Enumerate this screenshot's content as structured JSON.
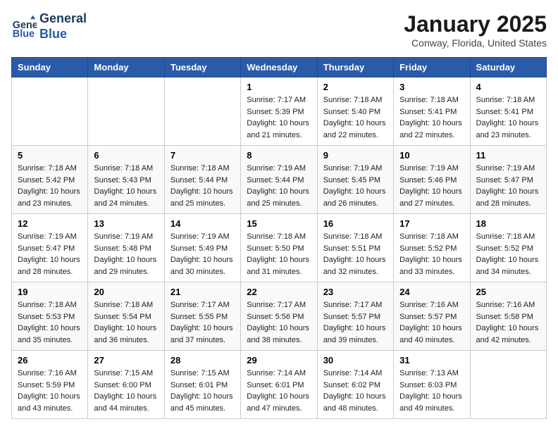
{
  "header": {
    "logo_line1": "General",
    "logo_line2": "Blue",
    "month_title": "January 2025",
    "location": "Conway, Florida, United States"
  },
  "days_of_week": [
    "Sunday",
    "Monday",
    "Tuesday",
    "Wednesday",
    "Thursday",
    "Friday",
    "Saturday"
  ],
  "weeks": [
    [
      {
        "day": "",
        "info": ""
      },
      {
        "day": "",
        "info": ""
      },
      {
        "day": "",
        "info": ""
      },
      {
        "day": "1",
        "info": "Sunrise: 7:17 AM\nSunset: 5:39 PM\nDaylight: 10 hours\nand 21 minutes."
      },
      {
        "day": "2",
        "info": "Sunrise: 7:18 AM\nSunset: 5:40 PM\nDaylight: 10 hours\nand 22 minutes."
      },
      {
        "day": "3",
        "info": "Sunrise: 7:18 AM\nSunset: 5:41 PM\nDaylight: 10 hours\nand 22 minutes."
      },
      {
        "day": "4",
        "info": "Sunrise: 7:18 AM\nSunset: 5:41 PM\nDaylight: 10 hours\nand 23 minutes."
      }
    ],
    [
      {
        "day": "5",
        "info": "Sunrise: 7:18 AM\nSunset: 5:42 PM\nDaylight: 10 hours\nand 23 minutes."
      },
      {
        "day": "6",
        "info": "Sunrise: 7:18 AM\nSunset: 5:43 PM\nDaylight: 10 hours\nand 24 minutes."
      },
      {
        "day": "7",
        "info": "Sunrise: 7:18 AM\nSunset: 5:44 PM\nDaylight: 10 hours\nand 25 minutes."
      },
      {
        "day": "8",
        "info": "Sunrise: 7:19 AM\nSunset: 5:44 PM\nDaylight: 10 hours\nand 25 minutes."
      },
      {
        "day": "9",
        "info": "Sunrise: 7:19 AM\nSunset: 5:45 PM\nDaylight: 10 hours\nand 26 minutes."
      },
      {
        "day": "10",
        "info": "Sunrise: 7:19 AM\nSunset: 5:46 PM\nDaylight: 10 hours\nand 27 minutes."
      },
      {
        "day": "11",
        "info": "Sunrise: 7:19 AM\nSunset: 5:47 PM\nDaylight: 10 hours\nand 28 minutes."
      }
    ],
    [
      {
        "day": "12",
        "info": "Sunrise: 7:19 AM\nSunset: 5:47 PM\nDaylight: 10 hours\nand 28 minutes."
      },
      {
        "day": "13",
        "info": "Sunrise: 7:19 AM\nSunset: 5:48 PM\nDaylight: 10 hours\nand 29 minutes."
      },
      {
        "day": "14",
        "info": "Sunrise: 7:19 AM\nSunset: 5:49 PM\nDaylight: 10 hours\nand 30 minutes."
      },
      {
        "day": "15",
        "info": "Sunrise: 7:18 AM\nSunset: 5:50 PM\nDaylight: 10 hours\nand 31 minutes."
      },
      {
        "day": "16",
        "info": "Sunrise: 7:18 AM\nSunset: 5:51 PM\nDaylight: 10 hours\nand 32 minutes."
      },
      {
        "day": "17",
        "info": "Sunrise: 7:18 AM\nSunset: 5:52 PM\nDaylight: 10 hours\nand 33 minutes."
      },
      {
        "day": "18",
        "info": "Sunrise: 7:18 AM\nSunset: 5:52 PM\nDaylight: 10 hours\nand 34 minutes."
      }
    ],
    [
      {
        "day": "19",
        "info": "Sunrise: 7:18 AM\nSunset: 5:53 PM\nDaylight: 10 hours\nand 35 minutes."
      },
      {
        "day": "20",
        "info": "Sunrise: 7:18 AM\nSunset: 5:54 PM\nDaylight: 10 hours\nand 36 minutes."
      },
      {
        "day": "21",
        "info": "Sunrise: 7:17 AM\nSunset: 5:55 PM\nDaylight: 10 hours\nand 37 minutes."
      },
      {
        "day": "22",
        "info": "Sunrise: 7:17 AM\nSunset: 5:56 PM\nDaylight: 10 hours\nand 38 minutes."
      },
      {
        "day": "23",
        "info": "Sunrise: 7:17 AM\nSunset: 5:57 PM\nDaylight: 10 hours\nand 39 minutes."
      },
      {
        "day": "24",
        "info": "Sunrise: 7:16 AM\nSunset: 5:57 PM\nDaylight: 10 hours\nand 40 minutes."
      },
      {
        "day": "25",
        "info": "Sunrise: 7:16 AM\nSunset: 5:58 PM\nDaylight: 10 hours\nand 42 minutes."
      }
    ],
    [
      {
        "day": "26",
        "info": "Sunrise: 7:16 AM\nSunset: 5:59 PM\nDaylight: 10 hours\nand 43 minutes."
      },
      {
        "day": "27",
        "info": "Sunrise: 7:15 AM\nSunset: 6:00 PM\nDaylight: 10 hours\nand 44 minutes."
      },
      {
        "day": "28",
        "info": "Sunrise: 7:15 AM\nSunset: 6:01 PM\nDaylight: 10 hours\nand 45 minutes."
      },
      {
        "day": "29",
        "info": "Sunrise: 7:14 AM\nSunset: 6:01 PM\nDaylight: 10 hours\nand 47 minutes."
      },
      {
        "day": "30",
        "info": "Sunrise: 7:14 AM\nSunset: 6:02 PM\nDaylight: 10 hours\nand 48 minutes."
      },
      {
        "day": "31",
        "info": "Sunrise: 7:13 AM\nSunset: 6:03 PM\nDaylight: 10 hours\nand 49 minutes."
      },
      {
        "day": "",
        "info": ""
      }
    ]
  ]
}
